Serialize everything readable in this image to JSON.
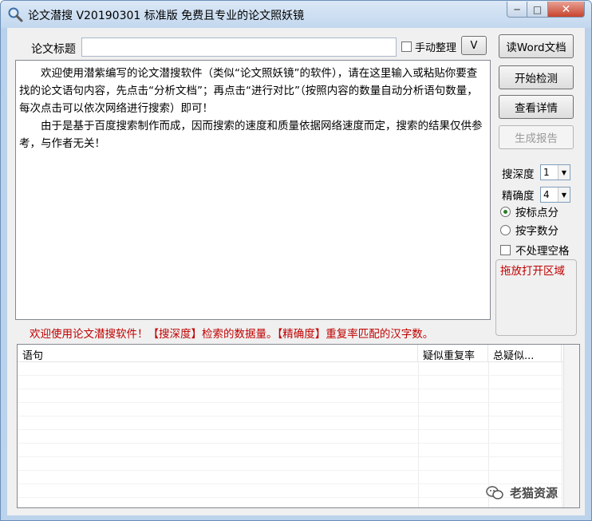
{
  "window": {
    "title": "论文潜搜 V20190301 标准版 免费且专业的论文照妖镜",
    "minimize": "─",
    "maximize": "□",
    "close": "✕"
  },
  "form": {
    "title_label": "论文标题",
    "title_value": "",
    "manual_label": "手动整理",
    "dropdown_label": "V",
    "content_paragraphs": [
      "欢迎使用潜紫编写的论文潜搜软件（类似“论文照妖镜”的软件），请在这里输入或粘贴你要查找的论文语句内容，先点击“分析文档”；再点击“进行对比”（按照内容的数量自动分析语句数量，每次点击可以依次网络进行搜索）即可！",
      "由于是基于百度搜索制作而成，因而搜索的速度和质量依据网络速度而定，搜索的结果仅供参考，与作者无关！"
    ],
    "status_text": "欢迎使用论文潜搜软件！【搜深度】检索的数据量。【精确度】重复率匹配的汉字数。"
  },
  "side": {
    "read_word": "读Word文档",
    "start": "开始检测",
    "details": "查看详情",
    "report": "生成报告",
    "depth_label": "搜深度",
    "depth_value": "1",
    "precision_label": "精确度",
    "precision_value": "4",
    "radio_punct": "按标点分",
    "radio_chars": "按字数分",
    "no_space": "不处理空格",
    "drop_zone": "拖放打开区域"
  },
  "table": {
    "headers": [
      "语句",
      "疑似重复率",
      "总疑似..."
    ]
  },
  "watermark": "老猫资源"
}
